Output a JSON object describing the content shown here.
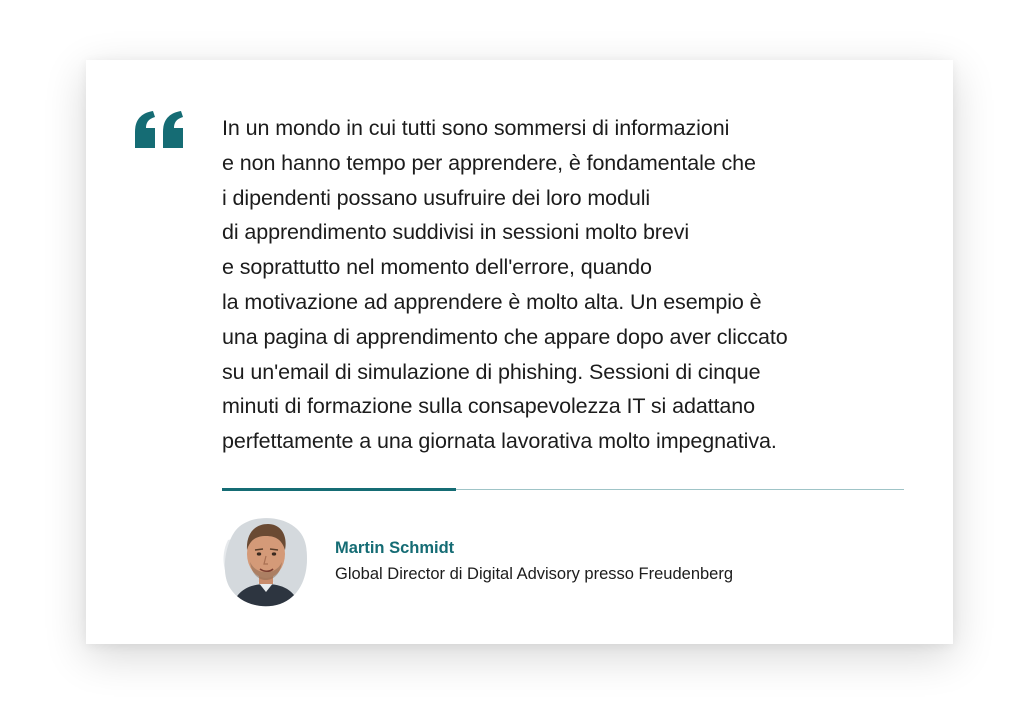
{
  "quote": {
    "lines": [
      "In un mondo in cui tutti sono sommersi di informazioni",
      "e non hanno tempo per apprendere, è fondamentale che",
      "i dipendenti possano usufruire dei loro moduli",
      "di apprendimento suddivisi in sessioni molto brevi",
      "e soprattutto nel momento dell'errore, quando",
      "la motivazione ad apprendere è molto alta. Un esempio è",
      "una pagina di apprendimento che appare dopo aver cliccato",
      "su un'email di simulazione di phishing. Sessioni di cinque",
      "minuti di formazione sulla consapevolezza IT si adattano",
      "perfettamente a una giornata lavorativa molto impegnativa."
    ],
    "icon": "quotation-mark-icon"
  },
  "author": {
    "name": "Martin Schmidt",
    "role": "Global Director di Digital Advisory presso Freudenberg",
    "avatar_icon": "person-portrait"
  },
  "colors": {
    "accent": "#156c74",
    "accent_light": "#9fc4c7",
    "text": "#1c1c1c",
    "background": "#ffffff"
  }
}
